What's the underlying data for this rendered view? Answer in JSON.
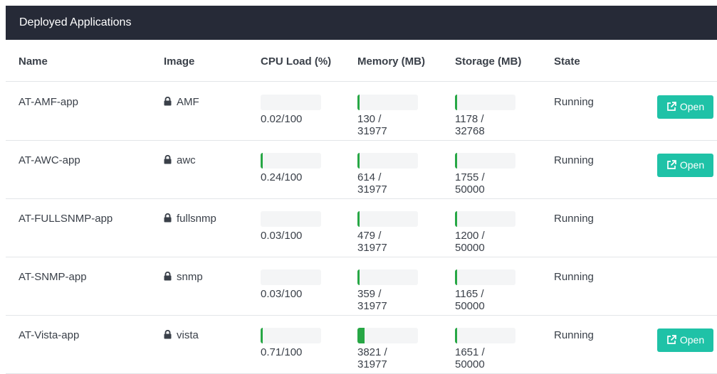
{
  "panel": {
    "title": "Deployed Applications"
  },
  "columns": {
    "name": "Name",
    "image": "Image",
    "cpu": "CPU Load (%)",
    "memory": "Memory (MB)",
    "storage": "Storage (MB)",
    "state": "State"
  },
  "colors": {
    "header_bg": "#262a37",
    "bar_fill": "#27a745",
    "open_button": "#1fc2a7"
  },
  "apps": [
    {
      "name": "AT-AMF-app",
      "image": "AMF",
      "cpu": "0.02/100",
      "cpu_frac": 0.0002,
      "memory": "130 / 31977",
      "memory_frac": 0.0041,
      "storage": "1178 / 32768",
      "storage_frac": 0.036,
      "state": "Running",
      "open_label": "Open"
    },
    {
      "name": "AT-AWC-app",
      "image": "awc",
      "cpu": "0.24/100",
      "cpu_frac": 0.0024,
      "memory": "614 / 31977",
      "memory_frac": 0.0192,
      "storage": "1755 / 50000",
      "storage_frac": 0.0351,
      "state": "Running",
      "open_label": "Open"
    },
    {
      "name": "AT-FULLSNMP-app",
      "image": "fullsnmp",
      "cpu": "0.03/100",
      "cpu_frac": 0.0003,
      "memory": "479 / 31977",
      "memory_frac": 0.015,
      "storage": "1200 / 50000",
      "storage_frac": 0.024,
      "state": "Running",
      "open_label": null
    },
    {
      "name": "AT-SNMP-app",
      "image": "snmp",
      "cpu": "0.03/100",
      "cpu_frac": 0.0003,
      "memory": "359 / 31977",
      "memory_frac": 0.0112,
      "storage": "1165 / 50000",
      "storage_frac": 0.0233,
      "state": "Running",
      "open_label": null
    },
    {
      "name": "AT-Vista-app",
      "image": "vista",
      "cpu": "0.71/100",
      "cpu_frac": 0.0071,
      "memory": "3821 / 31977",
      "memory_frac": 0.1195,
      "storage": "1651 / 50000",
      "storage_frac": 0.033,
      "state": "Running",
      "open_label": "Open"
    }
  ],
  "icons": {
    "image_lock": "lock-icon",
    "open_external": "external-link-icon"
  }
}
